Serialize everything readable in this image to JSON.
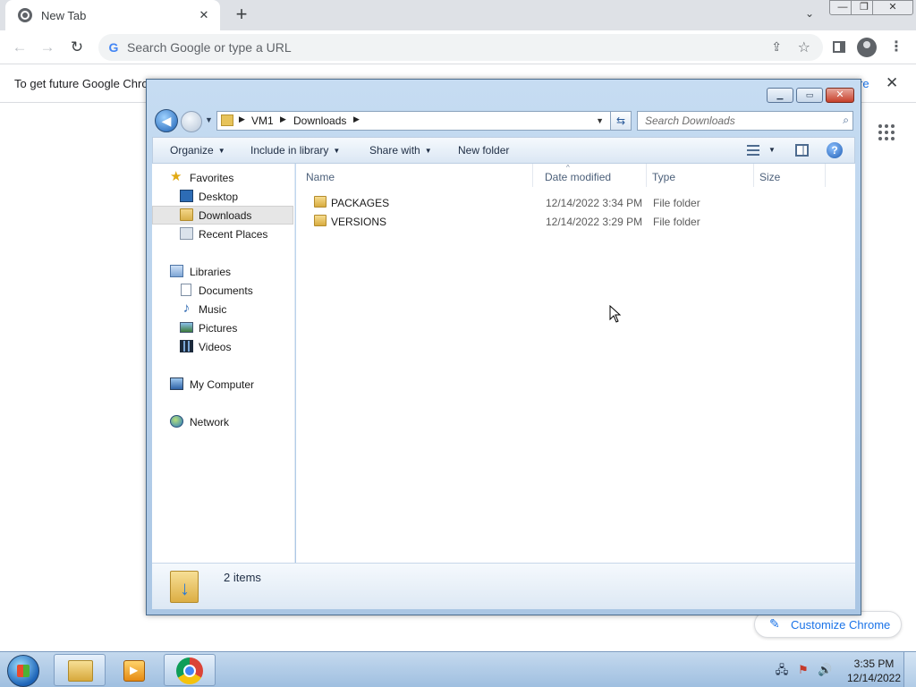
{
  "chrome": {
    "tab": {
      "title": "New Tab",
      "close": "✕"
    },
    "new_tab": "+",
    "tab_search": "⌄",
    "window_controls": {
      "minimize": "—",
      "maximize": "❐",
      "close": "✕"
    },
    "nav": {
      "back": "←",
      "forward": "→",
      "reload": "↻"
    },
    "omnibox": {
      "google_icon": "G",
      "placeholder": "Search Google or type a URL",
      "share": "⇪",
      "bookmark": "☆"
    },
    "menu": "⋮",
    "infobar": {
      "text": "To get future Google Chro",
      "link": "re",
      "close": "✕"
    },
    "customize": {
      "icon": "✎",
      "label": "Customize Chrome"
    }
  },
  "explorer": {
    "window_controls": {
      "minimize": "▁",
      "maximize": "▭",
      "close": "✕"
    },
    "address": {
      "crumbs": [
        "VM1",
        "Downloads"
      ],
      "arrows": [
        "▶",
        "▶",
        "▶"
      ],
      "dropdown": "▼",
      "refresh": "⇆",
      "history_dropdown": "▼"
    },
    "search": {
      "placeholder": "Search Downloads",
      "icon": "⌕"
    },
    "commands": {
      "organize": "Organize",
      "include_in_library": "Include in library",
      "share_with": "Share with",
      "new_folder": "New folder",
      "caret": "▼",
      "help": "?"
    },
    "nav_pane": {
      "favorites": "Favorites",
      "desktop": "Desktop",
      "downloads": "Downloads",
      "recent_places": "Recent Places",
      "libraries": "Libraries",
      "documents": "Documents",
      "music": "Music",
      "pictures": "Pictures",
      "videos": "Videos",
      "my_computer": "My Computer",
      "network": "Network"
    },
    "columns": {
      "name": "Name",
      "date_modified": "Date modified",
      "type": "Type",
      "size": "Size",
      "sort_caret": "^"
    },
    "files": [
      {
        "name": "PACKAGES",
        "date": "12/14/2022 3:34 PM",
        "type": "File folder"
      },
      {
        "name": "VERSIONS",
        "date": "12/14/2022 3:29 PM",
        "type": "File folder"
      }
    ],
    "status": {
      "count": "2 items"
    }
  },
  "taskbar": {
    "tray": {
      "network": "🖧",
      "action_center": "⚑",
      "volume": "🔊"
    },
    "clock": {
      "time": "3:35 PM",
      "date": "12/14/2022"
    }
  },
  "colors": {
    "accent": "#1a73e8",
    "explorer_frame": "#b9d1ea",
    "taskbar": "#9fbfe0"
  }
}
